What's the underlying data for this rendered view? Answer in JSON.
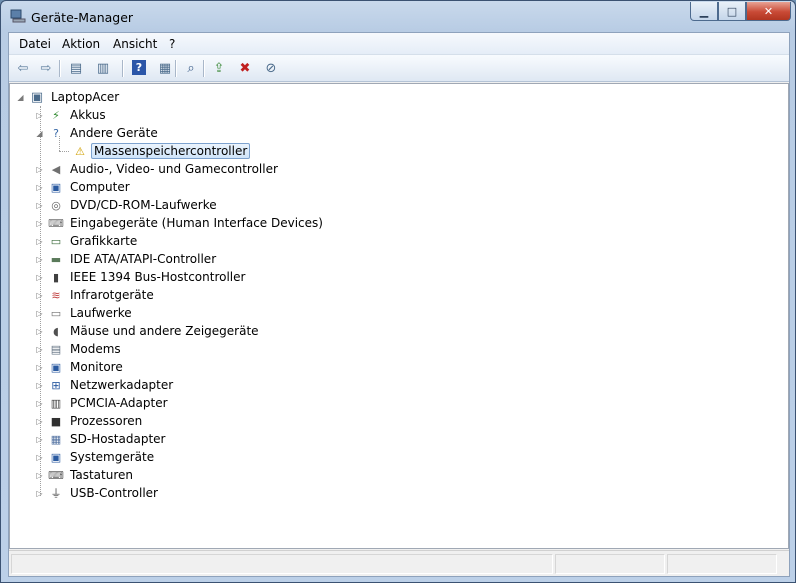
{
  "window": {
    "title": "Geräte-Manager"
  },
  "caption": {
    "minimize": "▁",
    "maximize": "□",
    "close": "✕"
  },
  "menu": [
    "Datei",
    "Aktion",
    "Ansicht",
    "?"
  ],
  "toolbar": [
    {
      "name": "back-icon",
      "glyph": "⇦"
    },
    {
      "name": "forward-icon",
      "glyph": "⇨"
    },
    {
      "name": "console-tree-icon",
      "glyph": "▤"
    },
    {
      "name": "properties-icon",
      "glyph": "▥"
    },
    {
      "name": "help-icon",
      "glyph": "?"
    },
    {
      "name": "show-pane-icon",
      "glyph": "▦"
    },
    {
      "name": "scan-hardware-icon",
      "glyph": "⌕"
    },
    {
      "name": "update-driver-icon",
      "glyph": "⇪"
    },
    {
      "name": "uninstall-icon",
      "glyph": "✖"
    },
    {
      "name": "disable-device-icon",
      "glyph": "⊘"
    }
  ],
  "tree": {
    "root": {
      "label": "LaptopAcer",
      "icon": "computer-icon"
    },
    "items": [
      {
        "label": "Akkus",
        "icon": "battery-icon",
        "glyph": "⚡",
        "expanded": false
      },
      {
        "label": "Andere Geräte",
        "icon": "unknown-device-icon",
        "glyph": "?",
        "expanded": true
      },
      {
        "label": "Massenspeichercontroller",
        "icon": "warning-device-icon",
        "glyph": "⚠",
        "child": true,
        "selected": true
      },
      {
        "label": "Audio-, Video- und Gamecontroller",
        "icon": "speaker-icon",
        "glyph": "◀"
      },
      {
        "label": "Computer",
        "icon": "monitor-icon",
        "glyph": "▣"
      },
      {
        "label": "DVD/CD-ROM-Laufwerke",
        "icon": "disc-drive-icon",
        "glyph": "◎"
      },
      {
        "label": "Eingabegeräte (Human Interface Devices)",
        "icon": "hid-icon",
        "glyph": "⌨"
      },
      {
        "label": "Grafikkarte",
        "icon": "display-adapter-icon",
        "glyph": "▭"
      },
      {
        "label": "IDE ATA/ATAPI-Controller",
        "icon": "ide-controller-icon",
        "glyph": "▬"
      },
      {
        "label": "IEEE 1394 Bus-Hostcontroller",
        "icon": "firewire-icon",
        "glyph": "▮"
      },
      {
        "label": "Infrarotgeräte",
        "icon": "infrared-icon",
        "glyph": "≋"
      },
      {
        "label": "Laufwerke",
        "icon": "drive-icon",
        "glyph": "▭"
      },
      {
        "label": "Mäuse und andere Zeigegeräte",
        "icon": "mouse-icon",
        "glyph": "◖"
      },
      {
        "label": "Modems",
        "icon": "modem-icon",
        "glyph": "▤"
      },
      {
        "label": "Monitore",
        "icon": "monitor-icon",
        "glyph": "▣"
      },
      {
        "label": "Netzwerkadapter",
        "icon": "network-adapter-icon",
        "glyph": "⊞"
      },
      {
        "label": "PCMCIA-Adapter",
        "icon": "pcmcia-icon",
        "glyph": "▥"
      },
      {
        "label": "Prozessoren",
        "icon": "processor-icon",
        "glyph": "■"
      },
      {
        "label": "SD-Hostadapter",
        "icon": "sd-host-icon",
        "glyph": "▦"
      },
      {
        "label": "Systemgeräte",
        "icon": "system-devices-icon",
        "glyph": "▣"
      },
      {
        "label": "Tastaturen",
        "icon": "keyboard-icon",
        "glyph": "⌨"
      },
      {
        "label": "USB-Controller",
        "icon": "usb-icon",
        "glyph": "⏚"
      }
    ]
  },
  "colors": {
    "selection": "#cfe4fa",
    "selection_border": "#7da2ce",
    "close_button": "#c94a36"
  }
}
